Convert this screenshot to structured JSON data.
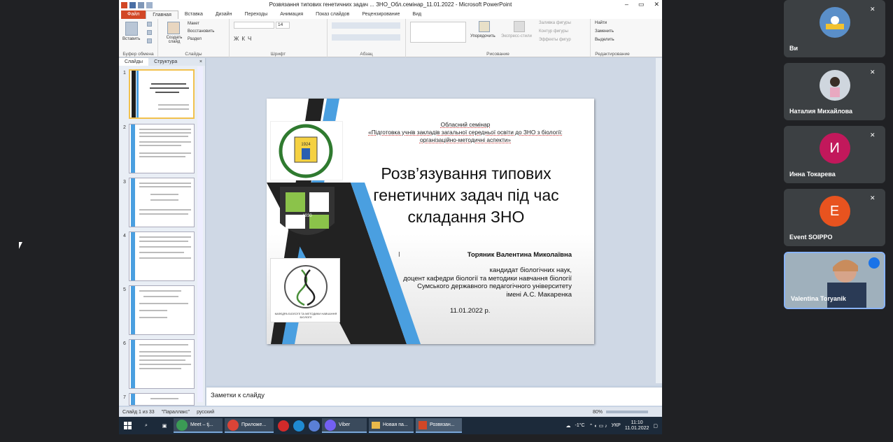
{
  "window": {
    "title": "Розвязання типових генетичних задач ... ЗНО_Обл.семінар_11.01.2022 - Microsoft PowerPoint"
  },
  "tabs": [
    "Файл",
    "Главная",
    "Вставка",
    "Дизайн",
    "Переходы",
    "Анимация",
    "Показ слайдов",
    "Рецензирование",
    "Вид"
  ],
  "ribbon": {
    "clipboard": {
      "paste": "Вставить",
      "label": "Буфер обмена"
    },
    "slides": {
      "create": "Создать слайд",
      "layout": "Макет",
      "reset": "Восстановить",
      "section": "Раздел",
      "label": "Слайды"
    },
    "font": {
      "size": "14",
      "label": "Шрифт"
    },
    "paragraph": {
      "label": "Абзац"
    },
    "drawing": {
      "arrange": "Упорядочить",
      "quick_styles": "Экспресс-стили",
      "fill": "Заливка фигуры",
      "outline": "Контур фигуры",
      "effects": "Эффекты фигур",
      "label": "Рисование"
    },
    "editing": {
      "find": "Найти",
      "replace": "Заменить",
      "select": "Выделить",
      "label": "Редактирование"
    }
  },
  "slides_panel": {
    "tab_slides": "Слайды",
    "tab_outline": "Структура",
    "close": "×",
    "numbers": [
      "1",
      "2",
      "3",
      "4",
      "5",
      "6",
      "7"
    ]
  },
  "slide": {
    "seminar_line1": "Обласний семінар",
    "seminar_line2": "«Підготовка учнів закладів загальної середньої освіти до ЗНО з біології:",
    "seminar_line3": "організаційно-методичні аспекти»",
    "title_line1": "Розв’язування типових",
    "title_line2": "генетичних задач під час",
    "title_line3": "складання ЗНО",
    "author": "Торяник Валентина Миколаївна",
    "desc1": "кандидат біологічних наук,",
    "desc2": "доцент кафедри біології та методики навчання біології",
    "desc3": "Сумського державного педагогічного університету",
    "desc4": "імені А.С. Макаренка",
    "date": "11.01.2022 р.",
    "logo1_year": "1924",
    "logo2_year": "1930",
    "logo3_caption": "КАФЕДРА БІОЛОГІЇ ТА МЕТОДИКИ НАВЧАННЯ БІОЛОГІЇ"
  },
  "notes": {
    "placeholder": "Заметки к слайду"
  },
  "status": {
    "slide": "Слайд 1 из 33",
    "theme": "\"Параллакс\"",
    "lang": "русский",
    "zoom": "80%"
  },
  "taskbar": {
    "apps": [
      "Meet – tj...",
      "Приложе...",
      "Viber",
      "Новая па...",
      "Розвязан..."
    ],
    "weather": "-1°C",
    "lang": "УКР",
    "time": "11:10",
    "date": "11.01.2022"
  },
  "participants": [
    {
      "name": "Ви",
      "initial": "",
      "color": "#5a8fc9"
    },
    {
      "name": "Наталия Михайлова",
      "initial": "",
      "color": "#cfd6de"
    },
    {
      "name": "Инна Токарева",
      "initial": "И",
      "color": "#c2185b"
    },
    {
      "name": "Event SOIPPO",
      "initial": "E",
      "color": "#e8531f"
    },
    {
      "name": "Valentina Toryanik",
      "initial": "",
      "color": "#c9a089"
    }
  ]
}
